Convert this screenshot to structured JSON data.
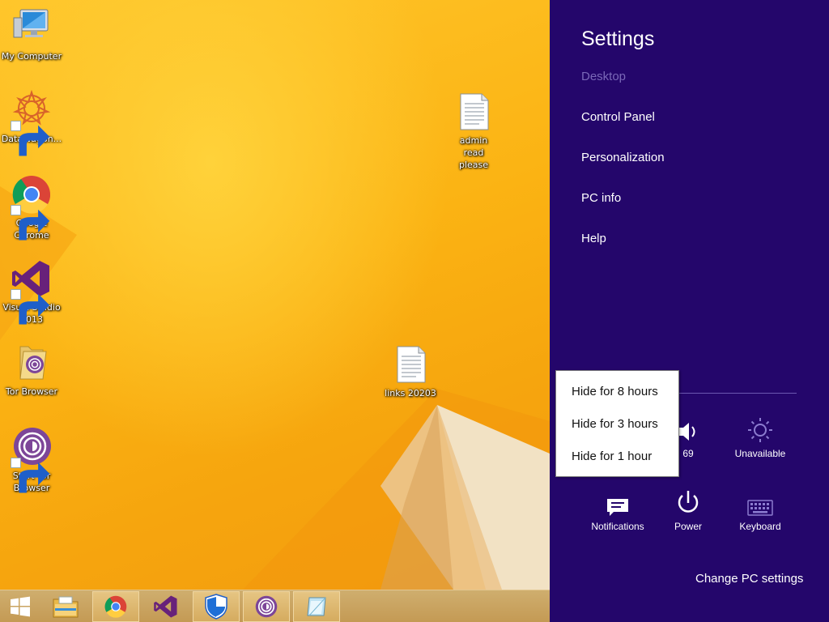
{
  "desktop": {
    "icons": [
      {
        "label": "My Computer",
        "icon": "computer-icon"
      },
      {
        "label": "DataWagon...",
        "icon": "datawagon-icon"
      },
      {
        "label": "Google Chrome",
        "icon": "chrome-icon"
      },
      {
        "label": "Visual Studio 2013",
        "icon": "visual-studio-icon"
      },
      {
        "label": "Tor Browser",
        "icon": "tor-folder-icon"
      },
      {
        "label": "Start Tor Browser",
        "icon": "tor-browser-icon"
      },
      {
        "label": "admin read please",
        "icon": "text-file-icon"
      },
      {
        "label": "links 20203",
        "icon": "text-file-icon"
      }
    ]
  },
  "taskbar": {
    "buttons": [
      {
        "name": "start",
        "icon": "windows-logo-icon"
      },
      {
        "name": "file-explorer",
        "icon": "folder-icon"
      },
      {
        "name": "chrome",
        "icon": "chrome-icon"
      },
      {
        "name": "visual-studio",
        "icon": "visual-studio-icon"
      },
      {
        "name": "windows-defender",
        "icon": "shield-icon"
      },
      {
        "name": "tor-browser",
        "icon": "tor-browser-icon"
      },
      {
        "name": "notepad",
        "icon": "notepad-icon"
      }
    ]
  },
  "settings": {
    "title": "Settings",
    "links": [
      "Desktop",
      "Control Panel",
      "Personalization",
      "PC info",
      "Help"
    ],
    "tiles": {
      "volume": "69",
      "brightness": "Unavailable",
      "notifications": "Notifications",
      "power": "Power",
      "keyboard": "Keyboard"
    },
    "change_pc_settings": "Change PC settings"
  },
  "hide_menu": {
    "items": [
      "Hide for 8 hours",
      "Hide for 3 hours",
      "Hide for 1 hour"
    ]
  },
  "colors": {
    "settings_bg": "#24066b",
    "desktop_accent": "#fbb313",
    "taskbar": "#c49a54"
  }
}
